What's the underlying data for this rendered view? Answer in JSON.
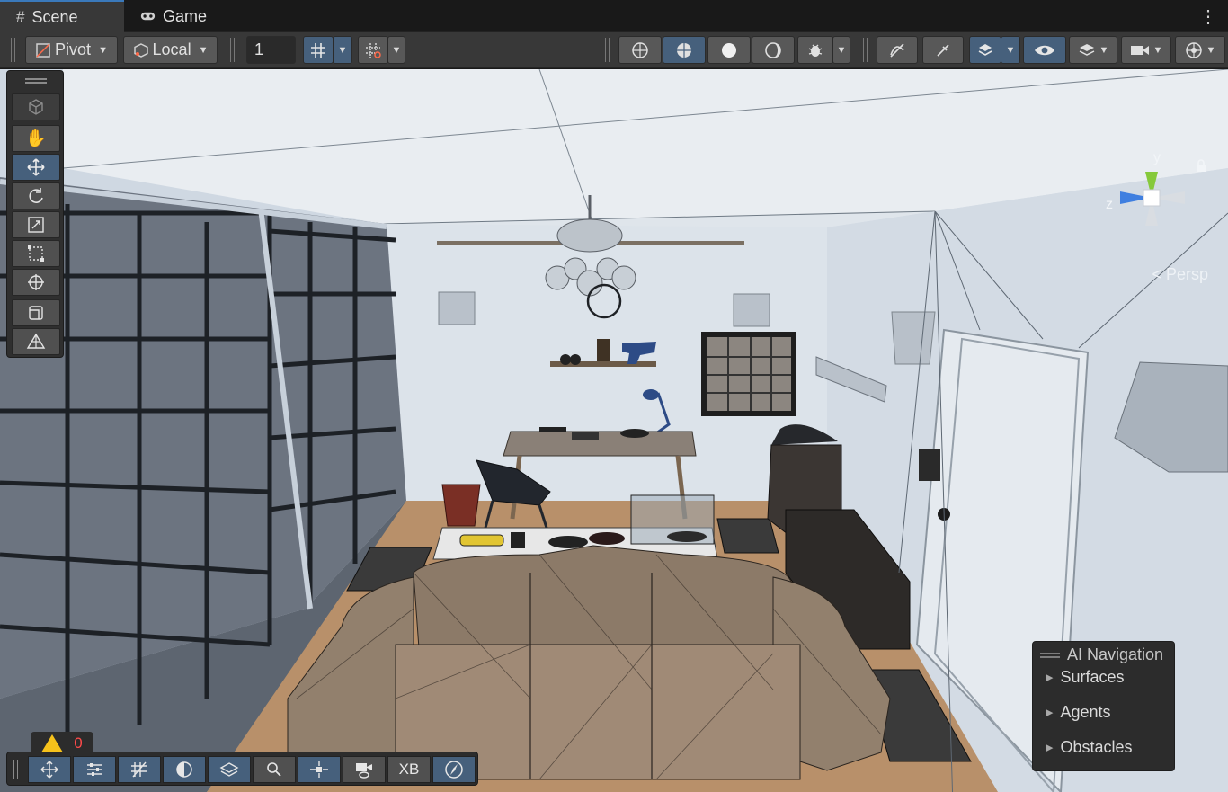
{
  "tabs": [
    {
      "label": "Scene",
      "icon": "grid-hash-icon",
      "active": true
    },
    {
      "label": "Game",
      "icon": "gamepad-icon",
      "active": false
    }
  ],
  "toolbar": {
    "pivot_label": "Pivot",
    "local_label": "Local",
    "grid_size_value": "1",
    "shading_modes": [
      "wireframe-shading-icon",
      "shaded-wireframe-shading-icon",
      "shaded-shading-icon",
      "unlit-shading-icon"
    ],
    "right_icons": [
      "debug-icon",
      "fx-off-icon",
      "tool-off-icon",
      "gizmos-icon",
      "visibility-icon",
      "layers-icon",
      "camera-icon",
      "gizmo-orientation-icon"
    ]
  },
  "tools": [
    "view-cube-icon",
    "hand-icon",
    "move-icon",
    "rotate-icon",
    "scale-icon",
    "rect-icon",
    "transform-icon",
    "custom-tool-icon",
    "probuilder-icon"
  ],
  "gizmo": {
    "y_label": "y",
    "z_label": "z",
    "projection_label": "< Persp"
  },
  "ai_navigation": {
    "title": "AI Navigation",
    "items": [
      "Surfaces",
      "Agents",
      "Obstacles"
    ]
  },
  "warnings": {
    "count": "0"
  },
  "bottom_tools": [
    "move-overlay-icon",
    "settings-sliders-icon",
    "grid-snap-icon",
    "lighting-icon",
    "layers-overlay-icon",
    "search-icon",
    "center-icon",
    "camera-view-icon",
    "xb-label",
    "compass-icon"
  ],
  "bottom_xb_label": "XB",
  "colors": {
    "accent": "#46607c",
    "tab_accent": "#3a79bb",
    "toolbar_bg": "#383838",
    "warning": "#f6c21b"
  }
}
